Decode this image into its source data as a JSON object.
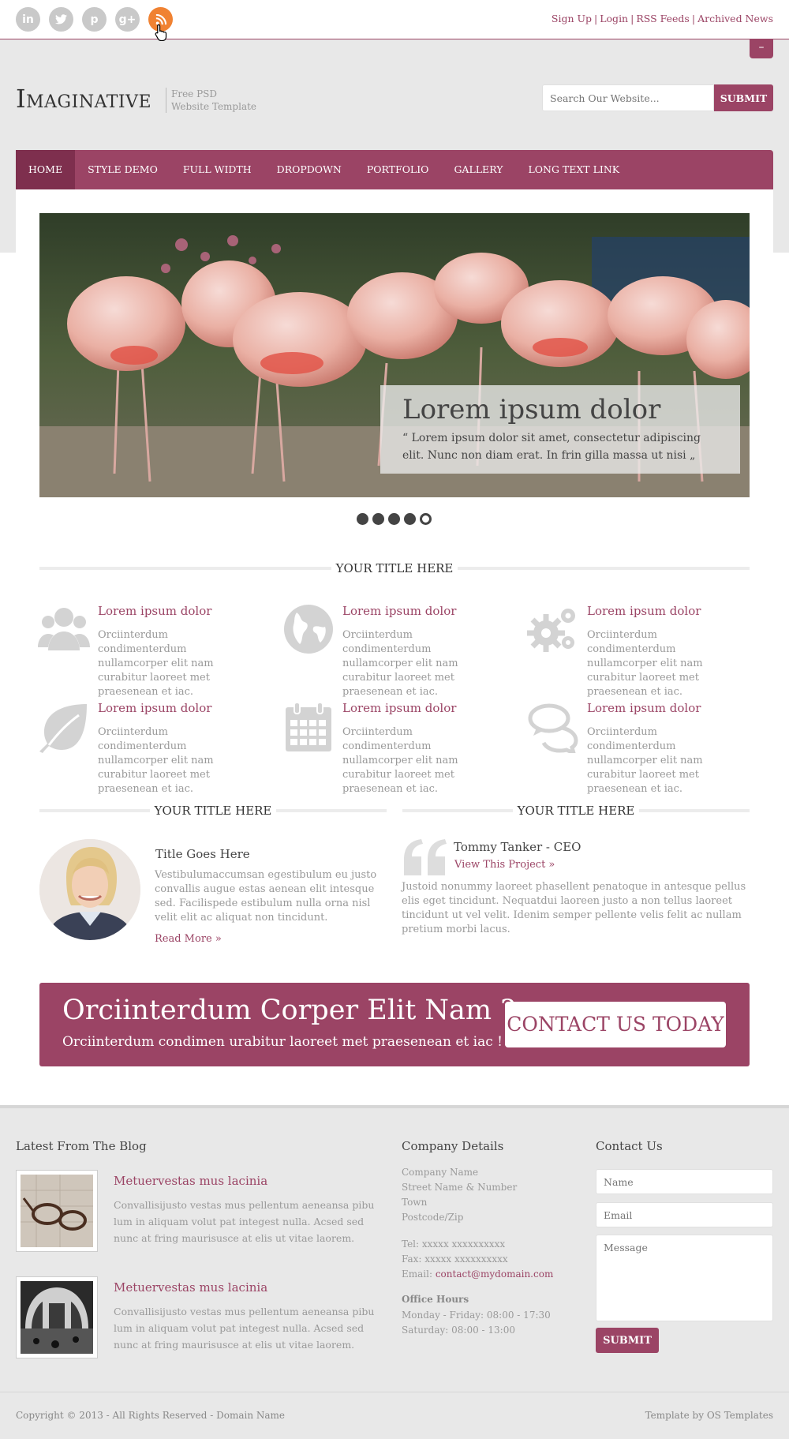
{
  "social": [
    {
      "icon": "linkedin-icon",
      "glyph": "in"
    },
    {
      "icon": "twitter-icon",
      "glyph": "t"
    },
    {
      "icon": "pinterest-icon",
      "glyph": "p"
    },
    {
      "icon": "google-plus-icon",
      "glyph": "g+"
    },
    {
      "icon": "rss-icon",
      "glyph": "))"
    }
  ],
  "toplinks": {
    "signup": "Sign Up",
    "login": "Login",
    "rss": "RSS Feeds",
    "archived": "Archived News",
    "sep": "|"
  },
  "toggle": "–",
  "header": {
    "logo": "Imaginative",
    "tagline1": "Free PSD",
    "tagline2": "Website Template",
    "search_placeholder": "Search Our Website...",
    "search_button": "SUBMIT"
  },
  "nav": [
    "HOME",
    "STYLE DEMO",
    "FULL WIDTH",
    "DROPDOWN",
    "PORTFOLIO",
    "GALLERY",
    "LONG TEXT LINK"
  ],
  "slider": {
    "title": "Lorem ipsum dolor",
    "text": "“ Lorem ipsum dolor sit amet, consectetur adipiscing elit. Nunc non diam erat. In frin gilla massa ut nisi „"
  },
  "section1_title": "YOUR TITLE HERE",
  "features": [
    {
      "icon": "users-icon",
      "title": "Lorem ipsum dolor",
      "text": "Orciinterdum condimenterdum nullamcorper elit nam curabitur laoreet met praesenean et iac."
    },
    {
      "icon": "globe-icon",
      "title": "Lorem ipsum dolor",
      "text": "Orciinterdum condimenterdum nullamcorper elit nam curabitur laoreet met praesenean et iac."
    },
    {
      "icon": "gears-icon",
      "title": "Lorem ipsum dolor",
      "text": "Orciinterdum condimenterdum nullamcorper elit nam curabitur laoreet met praesenean et iac."
    },
    {
      "icon": "leaf-icon",
      "title": "Lorem ipsum dolor",
      "text": "Orciinterdum condimenterdum nullamcorper elit nam curabitur laoreet met praesenean et iac."
    },
    {
      "icon": "calendar-icon",
      "title": "Lorem ipsum dolor",
      "text": "Orciinterdum condimenterdum nullamcorper elit nam curabitur laoreet met praesenean et iac."
    },
    {
      "icon": "chat-icon",
      "title": "Lorem ipsum dolor",
      "text": "Orciinterdum condimenterdum nullamcorper elit nam curabitur laoreet met praesenean et iac."
    }
  ],
  "about": {
    "section_title": "YOUR TITLE HERE",
    "title": "Title Goes Here",
    "text": "Vestibulumaccumsan egestibulum eu justo convallis augue estas aenean elit intesque sed. Facilispede estibulum nulla orna nisl velit elit ac aliquat non tincidunt.",
    "link": "Read More »"
  },
  "testimonial": {
    "section_title": "YOUR TITLE HERE",
    "name": "Tommy Tanker - CEO",
    "link": "View This Project »",
    "text": "Justoid nonummy laoreet phasellent penatoque in antesque pellus elis eget tincidunt. Nequatdui laoreen justo a non tellus laoreet tincidunt ut vel velit. Idenim semper pellente velis felit ac nullam pretium morbi lacus."
  },
  "cta": {
    "heading": "Orciinterdum Corper Elit Nam ?",
    "sub": "Orciinterdum condimen urabitur laoreet met praesenean et iac !",
    "button": "CONTACT US TODAY"
  },
  "footer": {
    "blog_title": "Latest From The Blog",
    "posts": [
      {
        "title": "Metuervestas mus lacinia",
        "text": "Convallisijusto vestas mus pellentum aeneansa pibu lum in aliquam volut pat integest nulla. Acsed sed nunc at fring maurisusce at elis ut vitae laorem."
      },
      {
        "title": "Metuervestas mus lacinia",
        "text": "Convallisijusto vestas mus pellentum aeneansa pibu lum in aliquam volut pat integest nulla. Acsed sed nunc at fring maurisusce at elis ut vitae laorem."
      }
    ],
    "company_title": "Company Details",
    "company": [
      "Company Name",
      "Street Name & Number",
      "Town",
      "Postcode/Zip"
    ],
    "tel": "Tel: xxxxx xxxxxxxxxx",
    "fax": "Fax: xxxxx xxxxxxxxxx",
    "email_label": "Email: ",
    "email": "contact@mydomain.com",
    "hours_title": "Office Hours",
    "hours1": "Monday - Friday: 08:00 - 17:30",
    "hours2": "Saturday: 08:00 - 13:00",
    "contact_title": "Contact Us",
    "name_placeholder": "Name",
    "email_placeholder": "Email",
    "message_placeholder": "Message",
    "submit": "SUBMIT"
  },
  "copyright": "Copyright © 2013 - All Rights Reserved - Domain Name",
  "credit": "Template by OS Templates",
  "colors": {
    "accent": "#9b4465",
    "accent_dark": "#7e2f4e",
    "rss": "#f08232"
  }
}
